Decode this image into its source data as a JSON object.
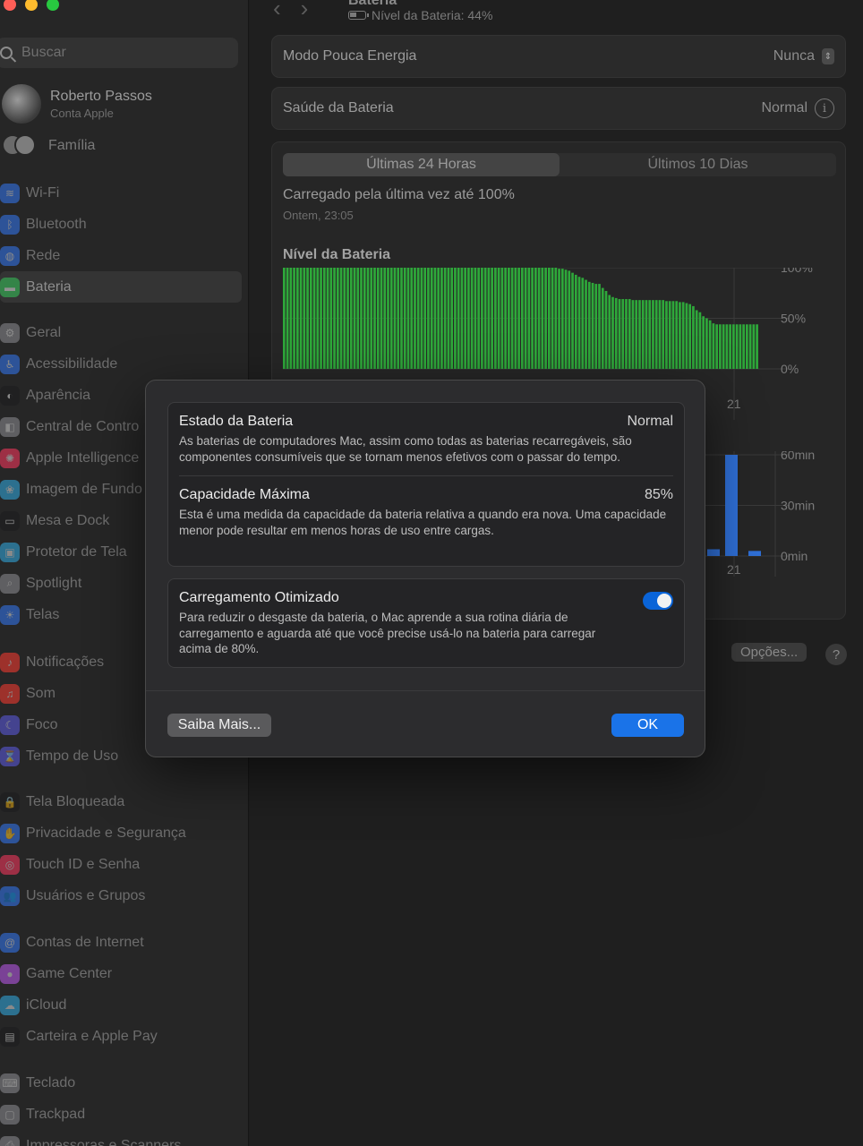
{
  "sidebar": {
    "search_placeholder": "Buscar",
    "account": {
      "name": "Roberto Passos",
      "subtitle": "Conta Apple"
    },
    "family_label": "Família",
    "groups": [
      [
        {
          "label": "Wi-Fi",
          "icon": "wifi-icon",
          "color": "#3478f6",
          "glyph": "≋"
        },
        {
          "label": "Bluetooth",
          "icon": "bluetooth-icon",
          "color": "#3478f6",
          "glyph": "ᛒ"
        },
        {
          "label": "Rede",
          "icon": "network-icon",
          "color": "#3478f6",
          "glyph": "◍"
        },
        {
          "label": "Bateria",
          "icon": "battery-icon",
          "color": "#34c759",
          "glyph": "▬",
          "selected": true
        }
      ],
      [
        {
          "label": "Geral",
          "icon": "gear-icon",
          "color": "#8e8e93",
          "glyph": "⚙"
        },
        {
          "label": "Acessibilidade",
          "icon": "accessibility-icon",
          "color": "#3478f6",
          "glyph": "♿"
        },
        {
          "label": "Aparência",
          "icon": "appearance-icon",
          "color": "#1c1c1e",
          "glyph": "◐"
        },
        {
          "label": "Central de Contro",
          "icon": "control-center-icon",
          "color": "#8e8e93",
          "glyph": "◧"
        },
        {
          "label": "Apple Intelligence",
          "icon": "apple-intelligence-icon",
          "color": "#ff375f",
          "glyph": "✺"
        },
        {
          "label": "Imagem de Fundo",
          "icon": "wallpaper-icon",
          "color": "#32ade6",
          "glyph": "❀"
        },
        {
          "label": "Mesa e Dock",
          "icon": "dock-icon",
          "color": "#1c1c1e",
          "glyph": "▭"
        },
        {
          "label": "Protetor de Tela",
          "icon": "screensaver-icon",
          "color": "#32ade6",
          "glyph": "▣"
        },
        {
          "label": "Spotlight",
          "icon": "spotlight-icon",
          "color": "#8e8e93",
          "glyph": "⌕"
        },
        {
          "label": "Telas",
          "icon": "displays-icon",
          "color": "#3478f6",
          "glyph": "☀"
        }
      ],
      [
        {
          "label": "Notificações",
          "icon": "notifications-icon",
          "color": "#ff3b30",
          "glyph": "♪"
        },
        {
          "label": "Som",
          "icon": "sound-icon",
          "color": "#ff3b30",
          "glyph": "♫"
        },
        {
          "label": "Foco",
          "icon": "focus-icon",
          "color": "#5e5ce6",
          "glyph": "☾"
        },
        {
          "label": "Tempo de Uso",
          "icon": "screen-time-icon",
          "color": "#5e5ce6",
          "glyph": "⌛"
        }
      ],
      [
        {
          "label": "Tela Bloqueada",
          "icon": "lock-icon",
          "color": "#1c1c1e",
          "glyph": "🔒"
        },
        {
          "label": "Privacidade e Segurança",
          "icon": "privacy-icon",
          "color": "#3478f6",
          "glyph": "✋"
        },
        {
          "label": "Touch ID e Senha",
          "icon": "touch-id-icon",
          "color": "#ff375f",
          "glyph": "◎"
        },
        {
          "label": "Usuários e Grupos",
          "icon": "users-icon",
          "color": "#3478f6",
          "glyph": "👥"
        }
      ],
      [
        {
          "label": "Contas de Internet",
          "icon": "internet-accounts-icon",
          "color": "#3478f6",
          "glyph": "@"
        },
        {
          "label": "Game Center",
          "icon": "game-center-icon",
          "color": "#bf5af2",
          "glyph": "●"
        },
        {
          "label": "iCloud",
          "icon": "icloud-icon",
          "color": "#32ade6",
          "glyph": "☁"
        },
        {
          "label": "Carteira e Apple Pay",
          "icon": "wallet-icon",
          "color": "#1c1c1e",
          "glyph": "▤"
        }
      ],
      [
        {
          "label": "Teclado",
          "icon": "keyboard-icon",
          "color": "#8e8e93",
          "glyph": "⌨"
        },
        {
          "label": "Trackpad",
          "icon": "trackpad-icon",
          "color": "#8e8e93",
          "glyph": "▢"
        },
        {
          "label": "Impressoras e Scanners",
          "icon": "printer-icon",
          "color": "#8e8e93",
          "glyph": "⎙"
        }
      ]
    ]
  },
  "header": {
    "title": "Bateria",
    "battery_level": "Nível da Bateria: 44%"
  },
  "rows": {
    "low_power_label": "Modo Pouca Energia",
    "low_power_value": "Nunca",
    "health_label": "Saúde da Bateria",
    "health_value": "Normal"
  },
  "usage": {
    "tabs": [
      "Últimas 24 Horas",
      "Últimos 10 Dias"
    ],
    "last_charged": "Carregado pela última vez até 100%",
    "last_charged_time": "Ontem, 23:05",
    "options_label": "Opções...",
    "help_label": "?"
  },
  "chart_data": [
    {
      "type": "bar",
      "title": "Nível da Bateria",
      "y_ticks": [
        "100%",
        "50%",
        "0%"
      ],
      "ylim": [
        0,
        100
      ],
      "x_tick": "21",
      "color": "#2ea83a",
      "values": [
        100,
        100,
        100,
        100,
        100,
        100,
        100,
        100,
        100,
        100,
        100,
        100,
        100,
        100,
        100,
        100,
        100,
        100,
        100,
        100,
        100,
        100,
        100,
        100,
        100,
        100,
        100,
        100,
        100,
        100,
        100,
        100,
        100,
        100,
        100,
        100,
        100,
        100,
        100,
        100,
        100,
        100,
        100,
        100,
        100,
        100,
        100,
        100,
        100,
        100,
        100,
        100,
        100,
        100,
        100,
        100,
        100,
        100,
        100,
        100,
        100,
        100,
        100,
        100,
        100,
        100,
        100,
        100,
        100,
        100,
        100,
        100,
        100,
        100,
        100,
        100,
        100,
        100,
        100,
        100,
        100,
        100,
        99,
        99,
        98,
        97,
        95,
        93,
        91,
        90,
        88,
        86,
        85,
        84,
        84,
        80,
        77,
        73,
        71,
        70,
        69,
        69,
        69,
        69,
        68,
        68,
        68,
        68,
        68,
        68,
        68,
        68,
        68,
        68,
        67,
        67,
        67,
        67,
        66,
        66,
        65,
        64,
        62,
        58,
        56,
        52,
        50,
        48,
        45,
        44,
        44,
        44,
        44,
        44,
        44,
        44,
        44,
        44,
        44,
        44,
        44,
        44
      ]
    },
    {
      "type": "bar",
      "title": "",
      "y_ticks": [
        "60min",
        "30min",
        "0min"
      ],
      "ylim": [
        0,
        60
      ],
      "x_tick": "21",
      "color": "#2f6fd6",
      "values": [
        4,
        60,
        3
      ]
    }
  ],
  "dialog": {
    "state_title": "Estado da Bateria",
    "state_value": "Normal",
    "state_desc": "As baterias de computadores Mac, assim como todas as baterias recarregáveis, são componentes consumíveis que se tornam menos efetivos com o passar do tempo.",
    "capacity_title": "Capacidade Máxima",
    "capacity_value": "85%",
    "capacity_desc": "Esta é uma medida da capacidade da bateria relativa a quando era nova. Uma capacidade menor pode resultar em menos horas de uso entre cargas.",
    "optimized_title": "Carregamento Otimizado",
    "optimized_desc": "Para reduzir o desgaste da bateria, o Mac aprende a sua rotina diária de carregamento e aguarda até que você precise usá-lo na bateria para carregar acima de 80%.",
    "optimized_on": true,
    "learn_more": "Saiba Mais...",
    "ok": "OK"
  }
}
